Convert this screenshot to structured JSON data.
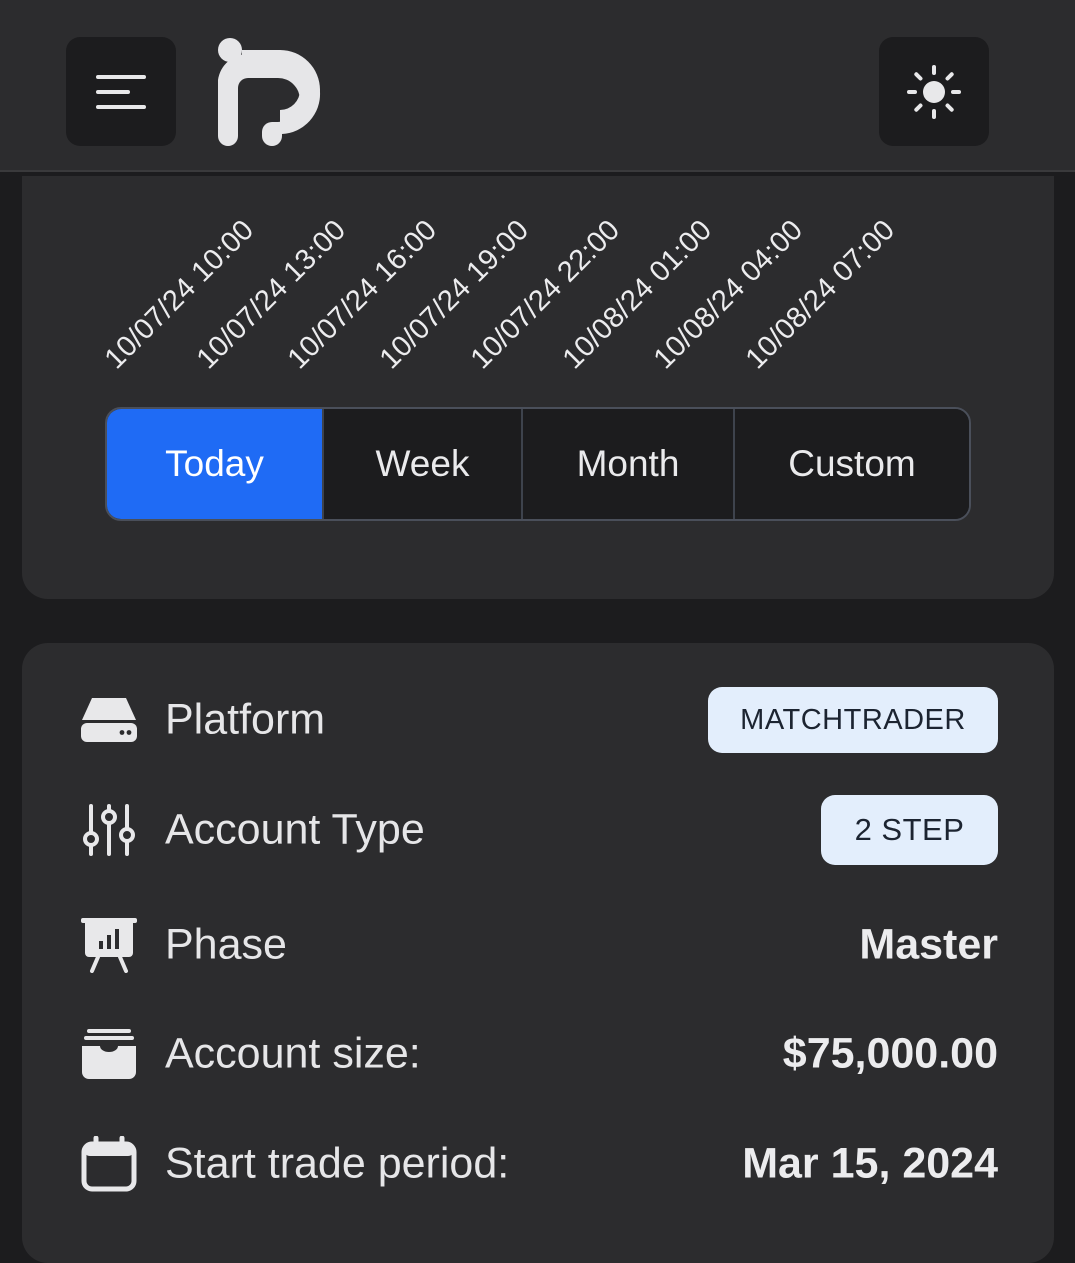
{
  "header": {
    "menu_icon": "hamburger-menu-icon",
    "logo_icon": "brand-logo",
    "theme_icon": "sun-icon"
  },
  "chart": {
    "x_ticks": [
      "10/07/24 10:00",
      "10/07/24 13:00",
      "10/07/24 16:00",
      "10/07/24 19:00",
      "10/07/24 22:00",
      "10/08/24 01:00",
      "10/08/24 04:00",
      "10/08/24 07:00"
    ]
  },
  "range_tabs": {
    "selected": "Today",
    "items": [
      {
        "label": "Today"
      },
      {
        "label": "Week"
      },
      {
        "label": "Month"
      },
      {
        "label": "Custom"
      }
    ],
    "active_color": "#1f6bf5"
  },
  "account": {
    "platform": {
      "label": "Platform",
      "value": "MATCHTRADER",
      "icon": "server-drive-icon"
    },
    "account_type": {
      "label": "Account Type",
      "value": "2 STEP",
      "icon": "sliders-icon"
    },
    "phase": {
      "label": "Phase",
      "value": "Master",
      "icon": "presentation-chart-icon"
    },
    "account_size": {
      "label": "Account size:",
      "value": "$75,000.00",
      "icon": "archive-box-icon"
    },
    "start_trade_period": {
      "label": "Start trade period:",
      "value": "Mar 15, 2024",
      "icon": "calendar-icon"
    }
  }
}
